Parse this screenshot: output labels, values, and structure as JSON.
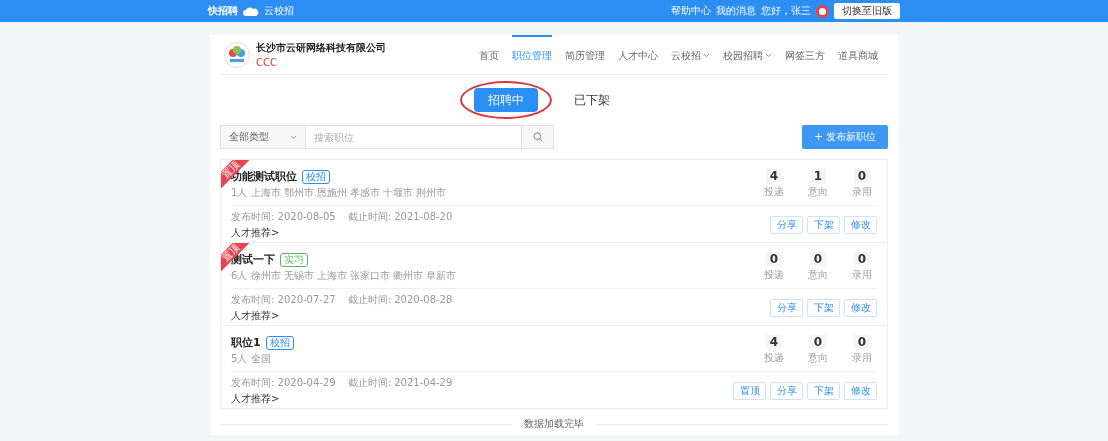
{
  "top_bar": {
    "logo": "快招聘",
    "sub_logo": "云校招",
    "links": [
      "帮助中心",
      "我的消息"
    ],
    "greeting": "您好，张三",
    "switch_button": "切换至旧版"
  },
  "company": {
    "name": "长沙市云研网络科技有限公司",
    "account": "CCC"
  },
  "nav": [
    {
      "label": "首页",
      "selected": false,
      "dropdown": false
    },
    {
      "label": "职位管理",
      "selected": true,
      "dropdown": false
    },
    {
      "label": "简历管理",
      "selected": false,
      "dropdown": false
    },
    {
      "label": "人才中心",
      "selected": false,
      "dropdown": false
    },
    {
      "label": "云校招",
      "selected": false,
      "dropdown": true
    },
    {
      "label": "校园招聘",
      "selected": false,
      "dropdown": true
    },
    {
      "label": "网签三方",
      "selected": false,
      "dropdown": false
    },
    {
      "label": "道具商城",
      "selected": false,
      "dropdown": false
    }
  ],
  "status_tabs": [
    {
      "label": "招聘中",
      "selected": true,
      "circled": true
    },
    {
      "label": "已下架",
      "selected": false,
      "circled": false
    }
  ],
  "filter": {
    "type_select": "全部类型",
    "search_placeholder": "搜索职位",
    "publish_button": "+ 发布新职位"
  },
  "jobs": [
    {
      "ribbon": "置顶",
      "title": "功能测试职位",
      "tag": "校招",
      "color": "#2a8ef2",
      "details": "1人 上海市 鄂州市 恩施州 孝感市 十堰市 荆州市",
      "published": "发布时间: 2020-08-05",
      "deadline": "截止时间: 2021-08-20",
      "recommend": "人才推荐>",
      "stats": [
        {
          "value": "4",
          "label": "投递"
        },
        {
          "value": "1",
          "label": "意向"
        },
        {
          "value": "0",
          "label": "录用"
        }
      ],
      "actions": [
        "分享",
        "下架",
        "修改"
      ]
    },
    {
      "ribbon": "置顶",
      "title": "测试一下",
      "tag": "实习",
      "color": "#5cb85c",
      "details": "6人 徐州市 无锡市 上海市 张家口市 衢州市 阜新市",
      "published": "发布时间: 2020-07-27",
      "deadline": "截止时间: 2020-08-28",
      "recommend": "人才推荐>",
      "stats": [
        {
          "value": "0",
          "label": "投递"
        },
        {
          "value": "0",
          "label": "意向"
        },
        {
          "value": "0",
          "label": "录用"
        }
      ],
      "actions": [
        "分享",
        "下架",
        "修改"
      ]
    },
    {
      "title": "职位1",
      "tag": "校招",
      "color": "#2a8ef2",
      "details": "5人 全国",
      "published": "发布时间: 2020-04-29",
      "deadline": "截止时间: 2021-04-29",
      "recommend": "人才推荐>",
      "stats": [
        {
          "value": "4",
          "label": "投递"
        },
        {
          "value": "0",
          "label": "意向"
        },
        {
          "value": "0",
          "label": "录用"
        }
      ],
      "actions": [
        "置顶",
        "分享",
        "下架",
        "修改"
      ]
    }
  ],
  "footer": "数据加载完毕"
}
